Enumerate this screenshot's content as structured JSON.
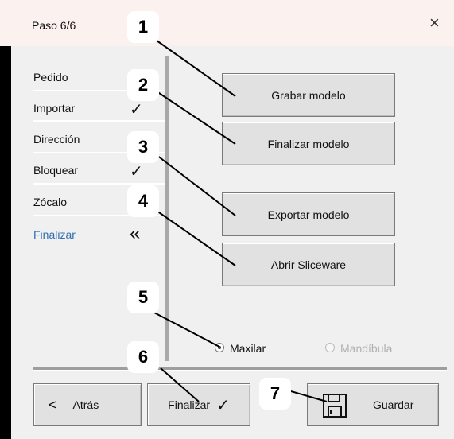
{
  "window": {
    "title": "Paso 6/6",
    "close_glyph": "×"
  },
  "steps": [
    {
      "label": "Pedido",
      "state": "done"
    },
    {
      "label": "Importar",
      "state": "done"
    },
    {
      "label": "Dirección",
      "state": "done"
    },
    {
      "label": "Bloquear",
      "state": "done"
    },
    {
      "label": "Zócalo",
      "state": "done"
    },
    {
      "label": "Finalizar",
      "state": "current"
    }
  ],
  "step_marks": {
    "done": "✓",
    "current": "«"
  },
  "actions": {
    "record_model": "Grabar modelo",
    "finish_model": "Finalizar modelo",
    "export_model": "Exportar modelo",
    "open_sliceware": "Abrir Sliceware"
  },
  "jaw": {
    "options": [
      {
        "label": "Maxilar",
        "selected": true,
        "enabled": true
      },
      {
        "label": "Mandíbula",
        "selected": false,
        "enabled": false
      }
    ]
  },
  "footer": {
    "back_label": "Atrás",
    "back_glyph": "<",
    "finish_label": "Finalizar",
    "finish_glyph": "✓",
    "save_label": "Guardar"
  },
  "callouts": [
    "1",
    "2",
    "3",
    "4",
    "5",
    "6",
    "7"
  ],
  "colors": {
    "active_step": "#2f6fb2",
    "title_bar": "#fbf2f0",
    "dialog_bg": "#f0f0f0"
  }
}
